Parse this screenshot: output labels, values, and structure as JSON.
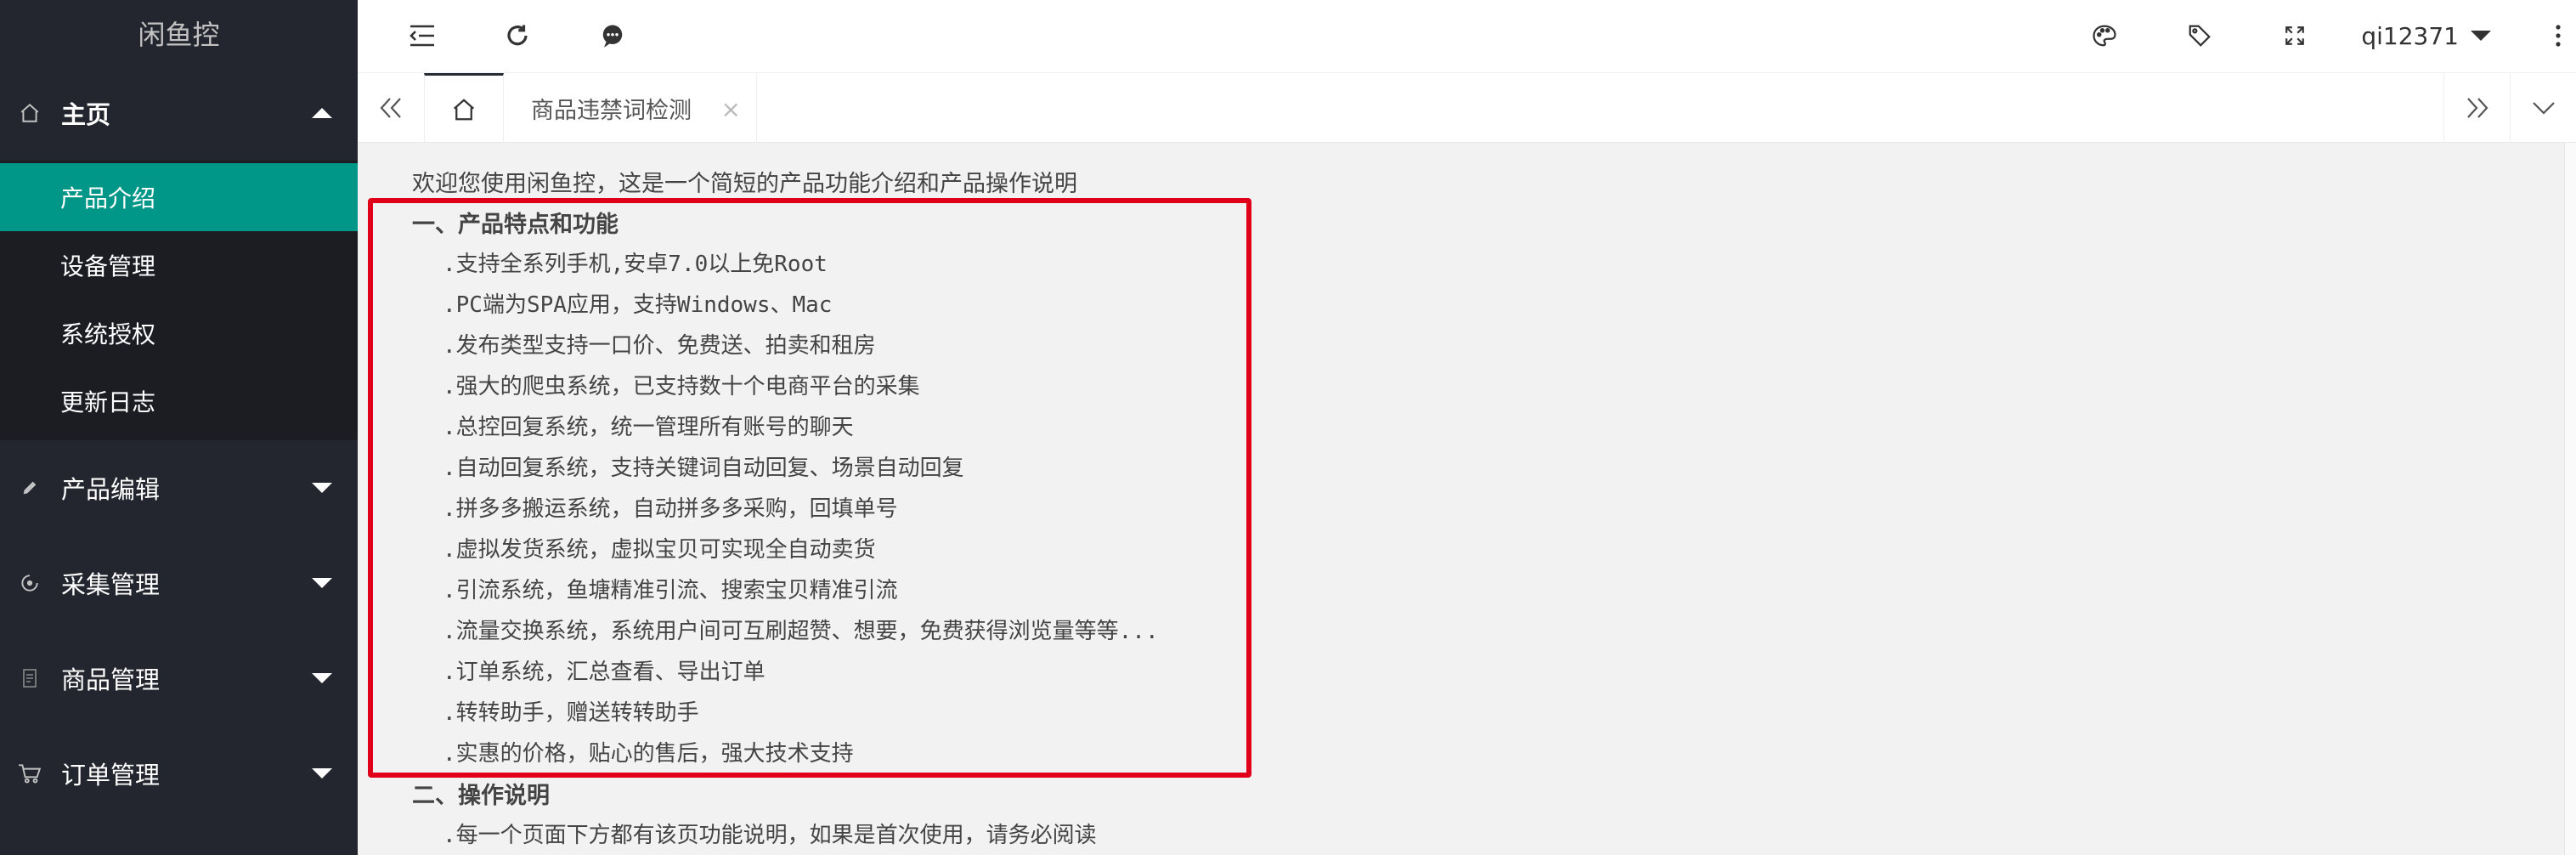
{
  "app": {
    "logo_text": "闲鱼控"
  },
  "sidebar": {
    "main": {
      "label": "主页",
      "icon": "home-icon",
      "items": [
        "产品介绍",
        "设备管理",
        "系统授权",
        "更新日志"
      ]
    },
    "groups": [
      {
        "label": "产品编辑",
        "icon": "pencil-icon"
      },
      {
        "label": "采集管理",
        "icon": "collect-icon"
      },
      {
        "label": "商品管理",
        "icon": "document-icon"
      },
      {
        "label": "订单管理",
        "icon": "cart-icon"
      }
    ]
  },
  "header": {
    "username": "qi12371"
  },
  "tabs": {
    "current": "商品违禁词检测",
    "close_symbol": "×"
  },
  "content": {
    "intro": "欢迎您使用闲鱼控，这是一个简短的产品功能介绍和产品操作说明",
    "section1_title": "一、产品特点和功能",
    "features": [
      ".支持全系列手机,安卓7.0以上免Root",
      ".PC端为SPA应用，支持Windows、Mac",
      ".发布类型支持一口价、免费送、拍卖和租房",
      ".强大的爬虫系统，已支持数十个电商平台的采集",
      ".总控回复系统，统一管理所有账号的聊天",
      ".自动回复系统，支持关键词自动回复、场景自动回复",
      ".拼多多搬运系统，自动拼多多采购，回填单号",
      ".虚拟发货系统，虚拟宝贝可实现全自动卖货",
      ".引流系统，鱼塘精准引流、搜索宝贝精准引流",
      ".流量交换系统，系统用户间可互刷超赞、想要，免费获得浏览量等等...",
      ".订单系统，汇总查看、导出订单",
      ".转转助手，赠送转转助手",
      ".实惠的价格，贴心的售后，强大技术支持"
    ],
    "section2_title": "二、操作说明",
    "instructions": [
      ".每一个页面下方都有该页功能说明，如果是首次使用，请务必阅读"
    ]
  },
  "colors": {
    "sidebar_bg": "#23262e",
    "active_item": "#009688",
    "highlight_border": "#e0001a"
  }
}
